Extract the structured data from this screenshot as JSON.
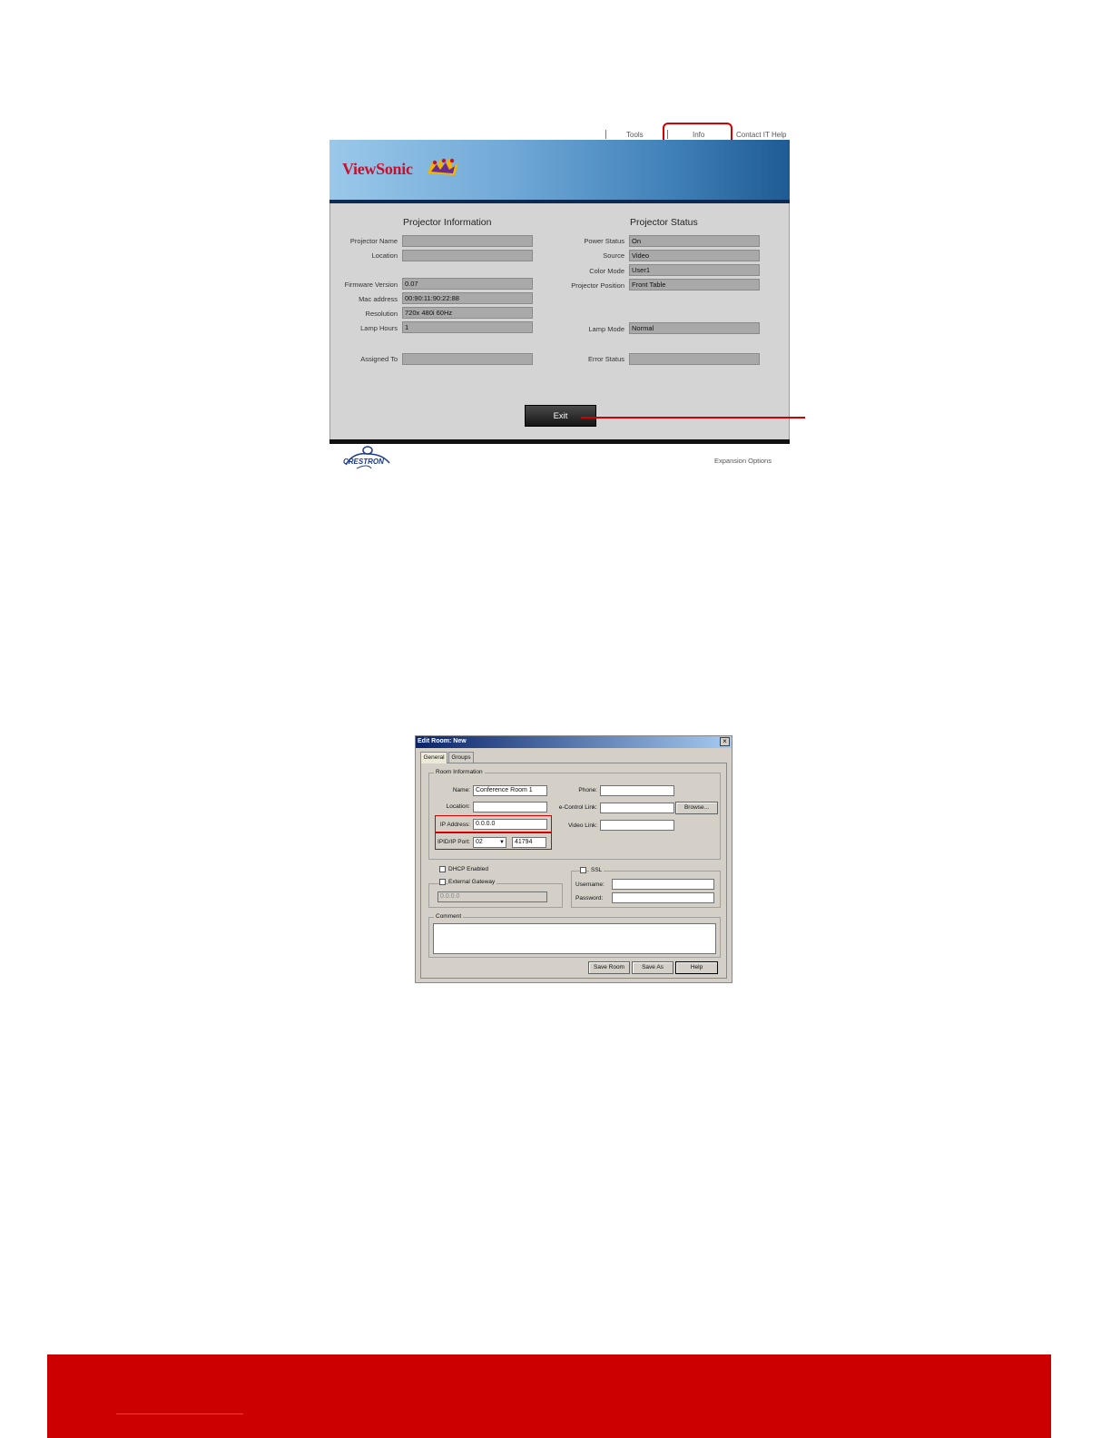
{
  "webui": {
    "nav": {
      "tools": "Tools",
      "info": "Info",
      "contact": "Contact IT Help"
    },
    "brand": "ViewSonic",
    "projector_info": {
      "title": "Projector Information",
      "fields": [
        {
          "label": "Projector Name",
          "value": ""
        },
        {
          "label": "Location",
          "value": ""
        },
        {
          "label": "Firmware Version",
          "value": "0.07"
        },
        {
          "label": "Mac address",
          "value": "00:90:11:90:22:88"
        },
        {
          "label": "Resolution",
          "value": "720x 480i 60Hz"
        },
        {
          "label": "Lamp Hours",
          "value": "1"
        },
        {
          "label": "Assigned To",
          "value": ""
        }
      ]
    },
    "projector_status": {
      "title": "Projector Status",
      "fields": [
        {
          "label": "Power Status",
          "value": "On"
        },
        {
          "label": "Source",
          "value": "Video"
        },
        {
          "label": "Color Mode",
          "value": "User1"
        },
        {
          "label": "Projector Position",
          "value": "Front Table"
        },
        {
          "label": "Lamp Mode",
          "value": "Normal"
        },
        {
          "label": "Error Status",
          "value": ""
        }
      ]
    },
    "exit_label": "Exit",
    "crestron": "CRESTRON",
    "expansion_options": "Expansion Options",
    "colors": {
      "highlight": "#d40000",
      "banner": "#3f7fb8"
    }
  },
  "dialog": {
    "title": "Edit Room: New",
    "tabs": [
      "General",
      "Groups"
    ],
    "room_info": {
      "title": "Room Information",
      "name_label": "Name:",
      "name_value": "Conference Room 1",
      "location_label": "Location:",
      "location_value": "",
      "ip_label": "IP Address:",
      "ip_value": "0.0.0.0",
      "ipid_label": "IPID/IP Port:",
      "ipid_value": "02",
      "port_value": "41794",
      "phone_label": "Phone:",
      "phone_value": "",
      "econtrol_label": "e-Control Link:",
      "econtrol_value": "",
      "browse_label": "Browse...",
      "video_label": "Video Link:",
      "video_value": ""
    },
    "dhcp_label": "DHCP Enabled",
    "gateway_label": "External Gateway",
    "gateway_value": "0.0.0.0",
    "ssl": {
      "title": "SSL",
      "username_label": "Username:",
      "password_label": "Password:"
    },
    "comment_title": "Comment",
    "buttons": {
      "save_room": "Save Room",
      "save_as": "Save As",
      "help": "Help"
    }
  },
  "footer": {
    "color": "#cc0000"
  }
}
